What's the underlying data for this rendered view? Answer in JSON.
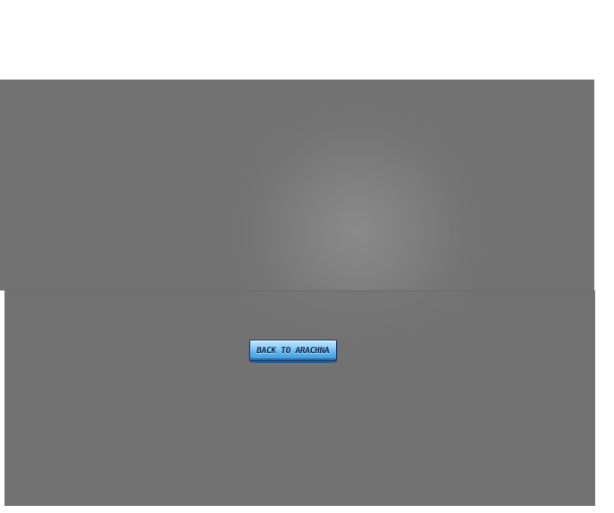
{
  "back_button": {
    "label": "BACK TO ARACHNA"
  },
  "colors": {
    "page_background": "#ffffff",
    "panel_gray": "#727272",
    "button_blue": "#5fb6f0",
    "button_text": "#102a4a"
  }
}
